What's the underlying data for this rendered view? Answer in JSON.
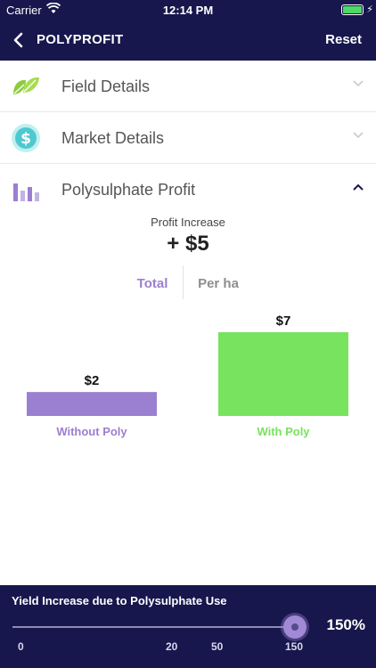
{
  "status_bar": {
    "carrier": "Carrier",
    "time": "12:14 PM"
  },
  "nav": {
    "back_icon": "chevron-left-icon",
    "title": "POLYPROFIT",
    "reset_label": "Reset"
  },
  "sections": [
    {
      "label": "Field Details",
      "icon": "leaf-icon",
      "expanded": false
    },
    {
      "label": "Market Details",
      "icon": "dollar-coin-icon",
      "expanded": false
    },
    {
      "label": "Polysulphate Profit",
      "icon": "bar-chart-icon",
      "expanded": true
    }
  ],
  "profit": {
    "label": "Profit Increase",
    "value": "+ $5"
  },
  "toggle": {
    "total_label": "Total",
    "per_ha_label": "Per ha",
    "selected": "Total"
  },
  "chart_data": {
    "type": "bar",
    "categories": [
      "Without Poly",
      "With Poly"
    ],
    "values": [
      2,
      7
    ],
    "data_labels": [
      "$2",
      "$7"
    ],
    "colors": [
      "#9b7fd0",
      "#78e35e"
    ],
    "title": "",
    "xlabel": "",
    "ylabel": "",
    "ylim": [
      0,
      7
    ]
  },
  "yield_slider": {
    "title": "Yield Increase due to Polysulphate Use",
    "value_label": "150%",
    "value": 150,
    "ticks": [
      "0",
      "20",
      "50",
      "150"
    ]
  },
  "colors": {
    "nav_bg": "#17174d",
    "accent_purple": "#9b7fd0",
    "accent_green": "#78e35e"
  }
}
